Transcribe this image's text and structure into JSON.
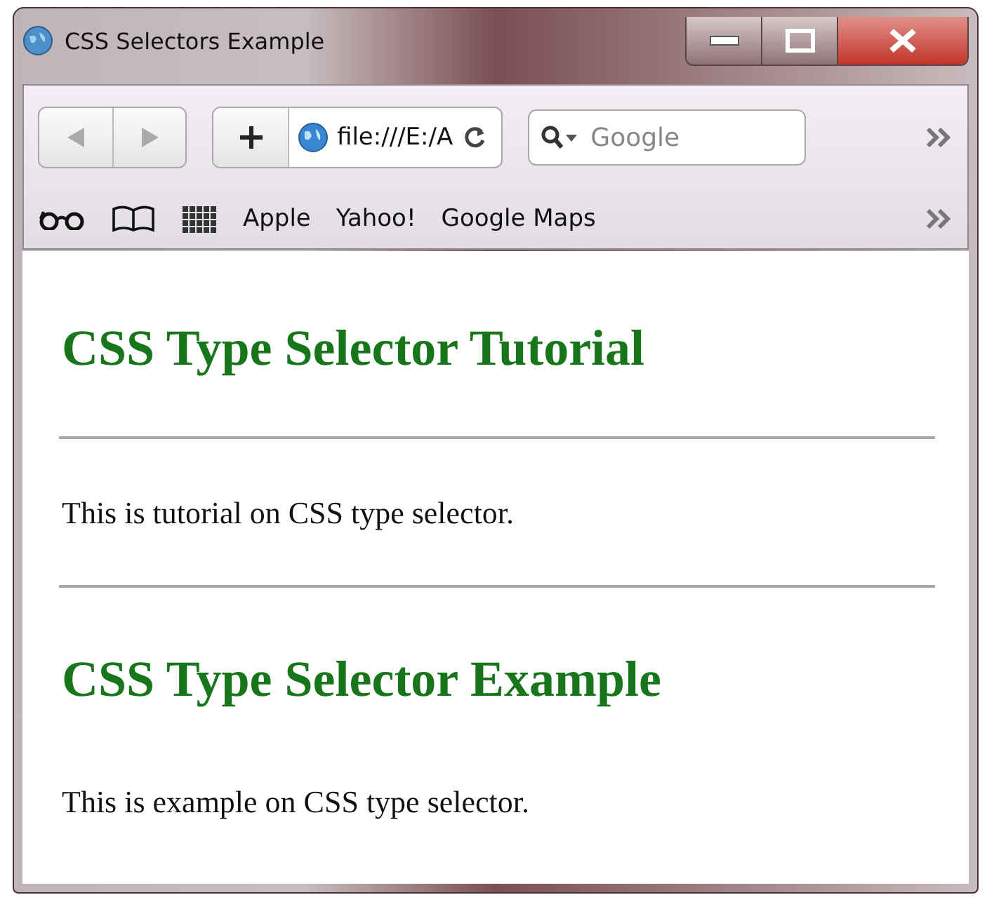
{
  "window": {
    "title": "CSS Selectors Example"
  },
  "toolbar": {
    "address": "file:///E:/A",
    "search": {
      "placeholder": "Google"
    }
  },
  "bookmarks": [
    "Apple",
    "Yahoo!",
    "Google Maps"
  ],
  "page": [
    {
      "kind": "heading",
      "text": "CSS Type Selector Tutorial"
    },
    {
      "kind": "rule"
    },
    {
      "kind": "paragraph",
      "text": "This is tutorial on CSS type selector."
    },
    {
      "kind": "rule"
    },
    {
      "kind": "heading",
      "text": "CSS Type Selector Example"
    },
    {
      "kind": "paragraph",
      "text": "This is example on CSS type selector."
    }
  ]
}
